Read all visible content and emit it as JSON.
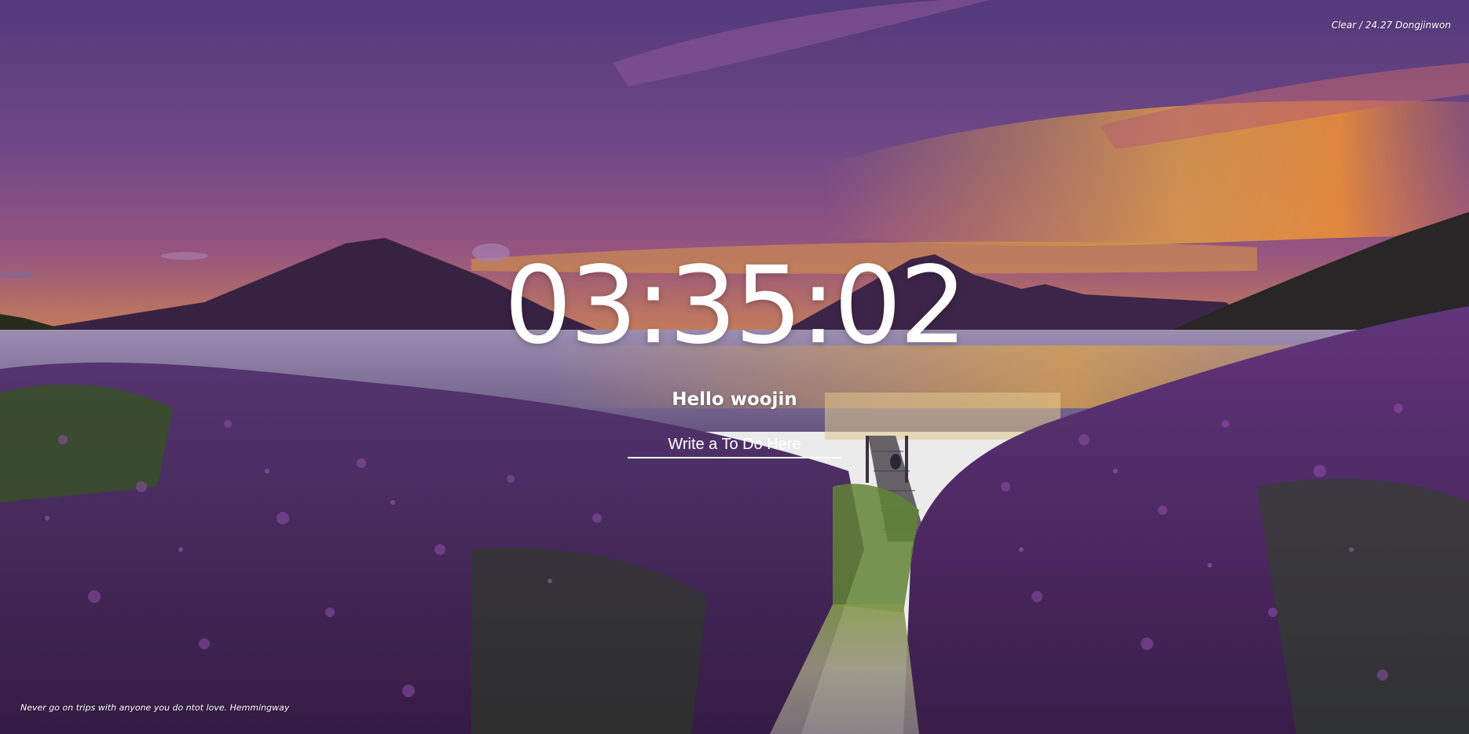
{
  "weather": {
    "text": "Clear / 24.27 Dongjinwon"
  },
  "clock": {
    "time": "03:35:02"
  },
  "greeting": {
    "text": "Hello woojin"
  },
  "todo": {
    "placeholder": "Write a To Do Here"
  },
  "quote": {
    "text": "Never go on trips with anyone you do ntot love. Hemmingway"
  },
  "background": {
    "scene": "sunset lake with volcanoes, wooden pier and purple flowers",
    "colors": {
      "sky_top": "#5b3f86",
      "sky_mid": "#8a5596",
      "horizon": "#e7a24a",
      "water": "#8f7fa8",
      "mountain": "#3b2547",
      "flowers": "#6e2f86",
      "foliage": "#3d5a24"
    }
  }
}
